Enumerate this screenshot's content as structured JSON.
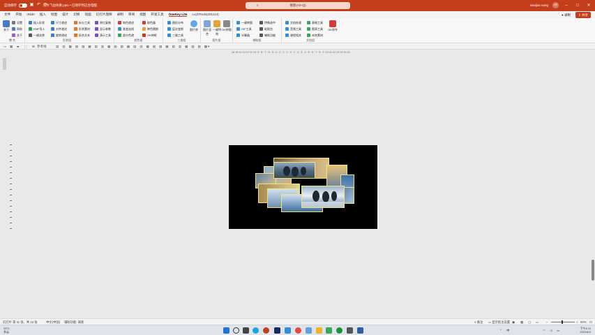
{
  "titlebar": {
    "autosave_label": "自动保存",
    "doc_title": "照片飞边效果.pptx • 已保存到这台电脑",
    "search_placeholder": "搜索(Alt+Q)",
    "user_name": "xiaojian song",
    "avatar_initials": "XS"
  },
  "menu": {
    "tabs": [
      "文件",
      "开始",
      "iSlide",
      "插入",
      "绘图",
      "设计",
      "切换",
      "动画",
      "幻灯片放映",
      "录制",
      "审阅",
      "视图",
      "开发工具",
      "OneKey Lite",
      "LvyhTools(201114)"
    ],
    "active_tab": "OneKey Lite",
    "record_label": "录制",
    "share_label": "共享"
  },
  "ribbon": {
    "groups": [
      {
        "label": "整 合",
        "big": "关于",
        "items": [
          "设置",
          "帮助",
          "关于"
        ]
      },
      {
        "label": "形状组",
        "items": [
          "插入形状",
          "EMF导入",
          "一键去除",
          "尺寸递进",
          "对齐递进",
          "旋转递进",
          "拆分工具",
          "形状素材",
          "拆合文本",
          "原位复制",
          "显示参数",
          "演示工具"
        ]
      },
      {
        "label": "颜色组",
        "items": [
          "纯色递进",
          "渐变连线",
          "部分色递",
          "取色器",
          "映色替换",
          "OK神框"
        ]
      },
      {
        "label": "三维组",
        "items": [
          "图形分布",
          "层次变换",
          "三维工具"
        ],
        "big": "图片库"
      },
      {
        "label": "图片组",
        "big_items": [
          "图片混合",
          "一键特效",
          "OK拼图"
        ]
      },
      {
        "label": "辅助组",
        "items": [
          "一键转图",
          "GIF工具",
          "计算器",
          "特殊选中",
          "粘贴包",
          "辅助功能"
        ]
      },
      {
        "label": "文档组",
        "items": [
          "文档处理",
          "音频工具",
          "课程相关",
          "表格工具",
          "图表工具",
          "本地素材"
        ],
        "big": "OK命令"
      }
    ]
  },
  "toolbar2": {
    "notes_label": "参考线"
  },
  "ruler": {
    "horizontal": "16·15·14·13·12·11·10· 9 · 8 · 7 · 6 · 5 · 4 · 3 · 2 · 1 · 0 · 1 · 2 · 3 · 4 · 5 · 6 · 7 · 8 · 9 ·10·11·12·13·14·15·16"
  },
  "status": {
    "slide_info": "幻灯片 第 11 张，共 12 张",
    "language": "中文(中国)",
    "accessibility": "辅助功能: 调查",
    "notes": "备注",
    "comments": "显示批注设置",
    "zoom": "50%"
  },
  "taskbar": {
    "weather_temp": "29°C",
    "weather_desc": "多云",
    "time": "下午4:12",
    "date": "2022/6/4"
  },
  "colors": {
    "accent": "#c43e1c",
    "photo_frame": "#f1e27b"
  }
}
